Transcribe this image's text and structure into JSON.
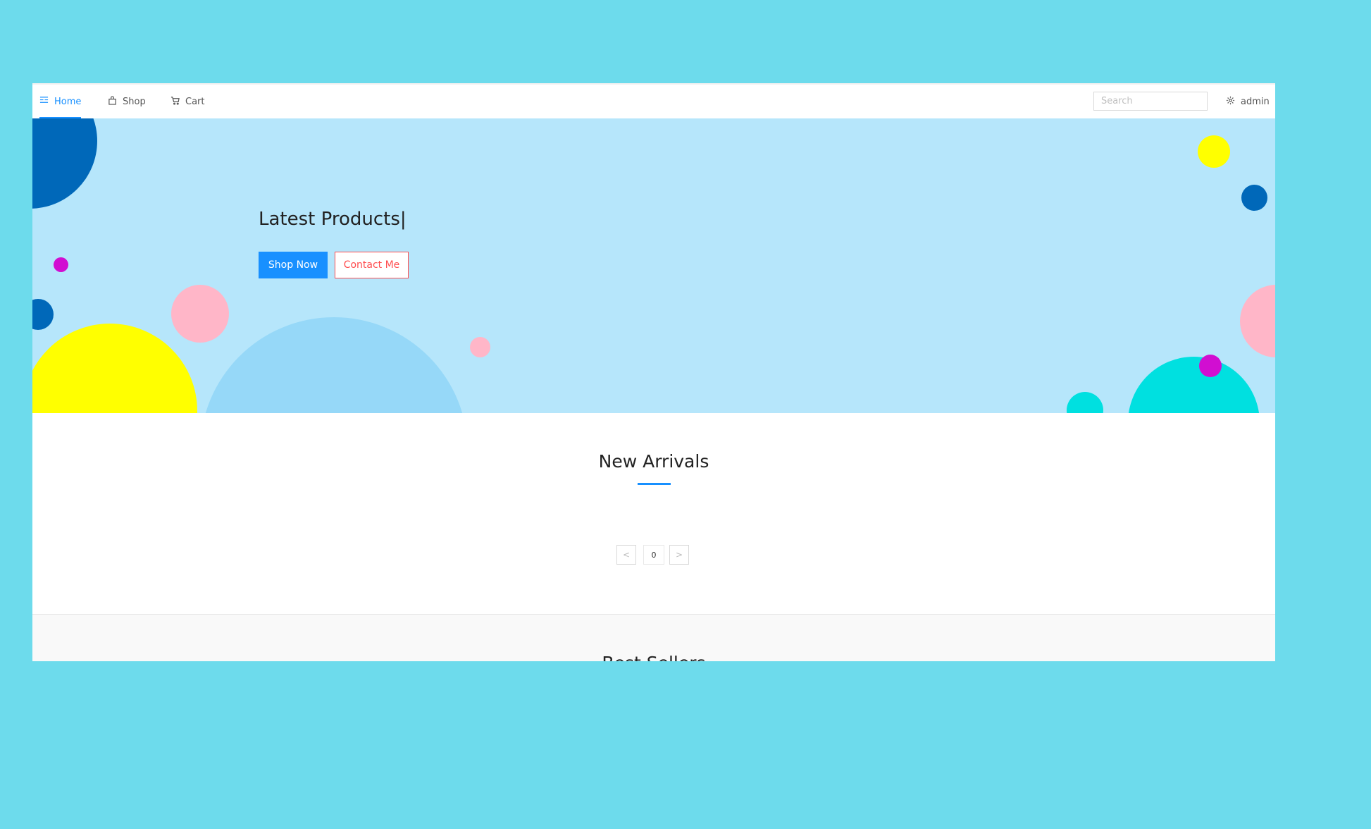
{
  "nav": {
    "items": [
      {
        "label": "Home",
        "icon": "home-icon",
        "active": true
      },
      {
        "label": "Shop",
        "icon": "shop-icon",
        "active": false
      },
      {
        "label": "Cart",
        "icon": "cart-icon",
        "active": false
      }
    ],
    "search_placeholder": "Search",
    "user_label": "admin",
    "user_icon": "gear-icon"
  },
  "hero": {
    "title": "Latest Products|",
    "primary_button": "Shop Now",
    "secondary_button": "Contact Me"
  },
  "new_arrivals": {
    "title": "New Arrivals",
    "pagination": {
      "prev": "<",
      "current": "0",
      "next": ">"
    }
  },
  "best_sellers": {
    "title": "Best Sellers"
  },
  "colors": {
    "background": "#6ddbec",
    "accent": "#1890ff",
    "danger": "#ff4d4f",
    "hero_background": "#b6e6fb"
  }
}
